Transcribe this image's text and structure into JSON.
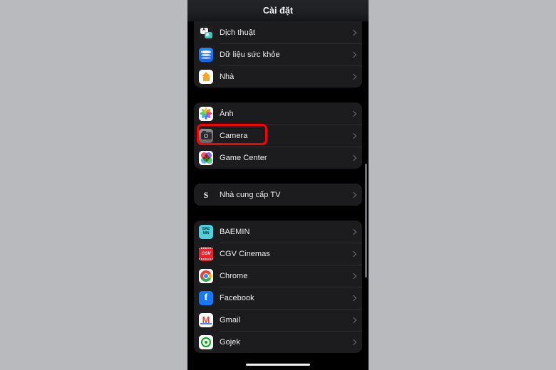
{
  "background_color": "#b9babe",
  "phone": {
    "screen_bg": "#000000",
    "card_bg": "#1c1c1e",
    "accent_highlight": "#ff0000"
  },
  "nav": {
    "title": "Cài đặt"
  },
  "sections": [
    {
      "id": "system-apps-top",
      "clipped_top": true,
      "rows": [
        {
          "label": "Dịch thuật",
          "icon": "translate-icon"
        },
        {
          "label": "Dữ liệu sức khỏe",
          "icon": "health-icon"
        },
        {
          "label": "Nhà",
          "icon": "home-icon"
        }
      ]
    },
    {
      "id": "media-apps",
      "clipped_top": false,
      "rows": [
        {
          "label": "Ảnh",
          "icon": "photos-icon"
        },
        {
          "label": "Camera",
          "icon": "camera-icon",
          "highlighted": true
        },
        {
          "label": "Game Center",
          "icon": "game-center-icon"
        }
      ]
    },
    {
      "id": "tv-provider",
      "clipped_top": false,
      "rows": [
        {
          "label": "Nhà cung cấp TV",
          "icon": "tv-provider-icon"
        }
      ]
    },
    {
      "id": "third-party-apps",
      "clipped_top": false,
      "rows": [
        {
          "label": "BAEMIN",
          "icon": "baemin-icon"
        },
        {
          "label": "CGV Cinemas",
          "icon": "cgv-icon"
        },
        {
          "label": "Chrome",
          "icon": "chrome-icon"
        },
        {
          "label": "Facebook",
          "icon": "facebook-icon"
        },
        {
          "label": "Gmail",
          "icon": "gmail-icon"
        },
        {
          "label": "Gojek",
          "icon": "gojek-icon"
        }
      ]
    }
  ],
  "chevron_icon": "chevron-right-icon",
  "scrollbar": {
    "visible": true
  },
  "home_indicator": {
    "visible": true
  }
}
